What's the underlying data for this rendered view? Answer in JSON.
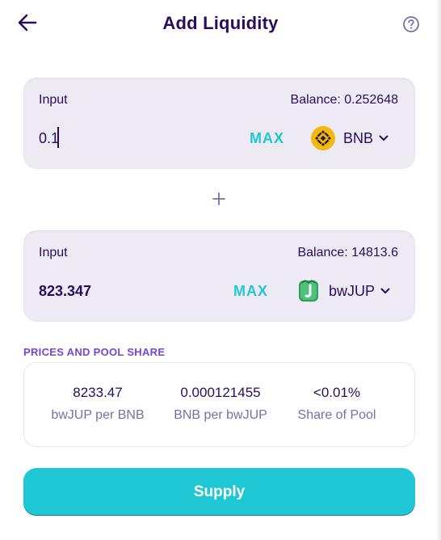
{
  "header": {
    "title": "Add Liquidity"
  },
  "input_a": {
    "label": "Input",
    "balance": "Balance: 0.252648",
    "value": "0.1",
    "max_label": "MAX",
    "token": "BNB",
    "token_icon": "bnb-icon"
  },
  "plus_icon": "plus-icon",
  "input_b": {
    "label": "Input",
    "balance": "Balance: 14813.6",
    "value": "823.347",
    "max_label": "MAX",
    "token": "bwJUP",
    "token_icon": "bwjup-icon"
  },
  "pool": {
    "section_title": "PRICES AND POOL SHARE",
    "stats": [
      {
        "value": "8233.47",
        "label": "bwJUP per BNB"
      },
      {
        "value": "0.000121455",
        "label": "BNB per bwJUP"
      },
      {
        "value": "<0.01%",
        "label": "Share of Pool"
      }
    ]
  },
  "supply_label": "Supply",
  "colors": {
    "primary_text": "#280d5f",
    "accent": "#1fc7d4",
    "secondary": "#7645d9",
    "muted_text": "#7a6eaa",
    "panel_bg": "#eeeaf4",
    "bnb_yellow": "#f0b90b",
    "bwjup_green": "#2e9e5a"
  }
}
